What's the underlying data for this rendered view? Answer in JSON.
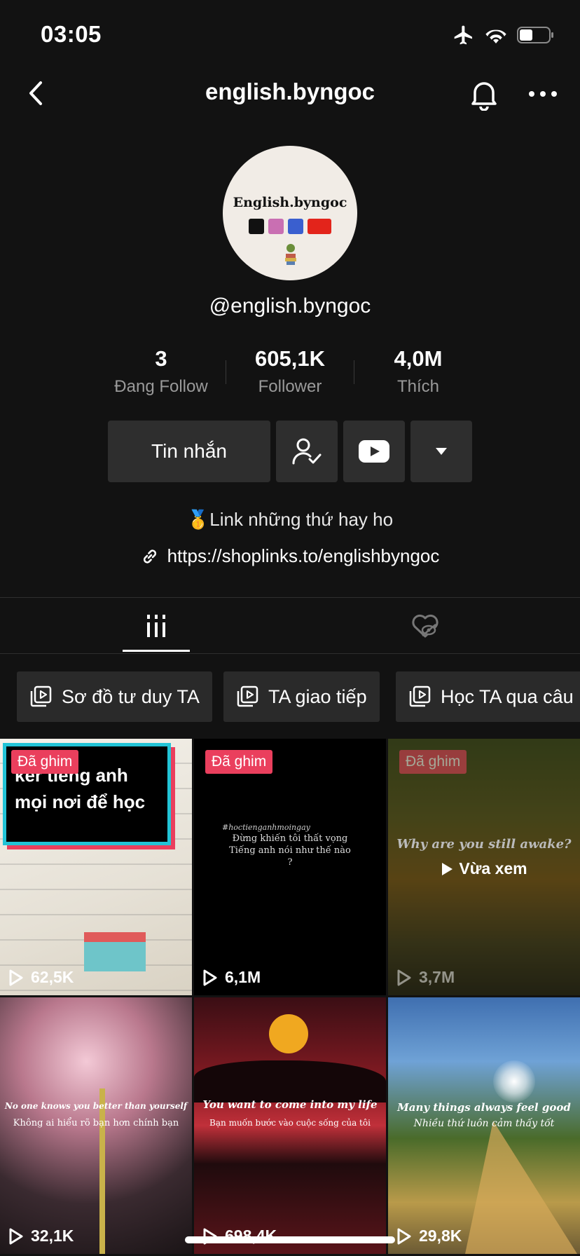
{
  "status_bar": {
    "time": "03:05"
  },
  "nav": {
    "title": "english.byngoc"
  },
  "profile": {
    "avatar_text": "English.byngoc",
    "handle": "@english.byngoc",
    "stats": [
      {
        "value": "3",
        "label": "Đang Follow"
      },
      {
        "value": "605,1K",
        "label": "Follower"
      },
      {
        "value": "4,0M",
        "label": "Thích"
      }
    ],
    "message_label": "Tin nhắn",
    "bio": "🥇Link những thứ hay ho",
    "link": "https://shoplinks.to/englishbyngoc"
  },
  "playlists": [
    {
      "label": "Sơ đồ tư duy TA"
    },
    {
      "label": "TA giao tiếp"
    },
    {
      "label": "Học TA qua câu"
    }
  ],
  "videos": [
    {
      "views": "62,5K",
      "pinned": "Đã ghim",
      "caption": "ker tiếng anh mọi nơi để học"
    },
    {
      "views": "6,1M",
      "pinned": "Đã ghim",
      "caption_small": "#hoctienganhmoingay",
      "caption": "Đừng khiến tôi thất vọng Tiếng anh nói như thế nào ?"
    },
    {
      "views": "3,7M",
      "pinned": "Đã ghim",
      "caption": "Why are you still awake?",
      "seen_label": "Vừa xem"
    },
    {
      "views": "32,1K",
      "caption": "No one knows you better than yourself",
      "caption_vi": "Không ai hiểu rõ bạn hơn chính bạn"
    },
    {
      "views": "698,4K",
      "caption": "You want to come into my life",
      "caption_vi": "Bạn muốn bước vào cuộc sống của tôi"
    },
    {
      "views": "29,8K",
      "caption": "Many things always feel good",
      "caption_vi": "Nhiều thứ luôn cảm thấy tốt"
    }
  ]
}
